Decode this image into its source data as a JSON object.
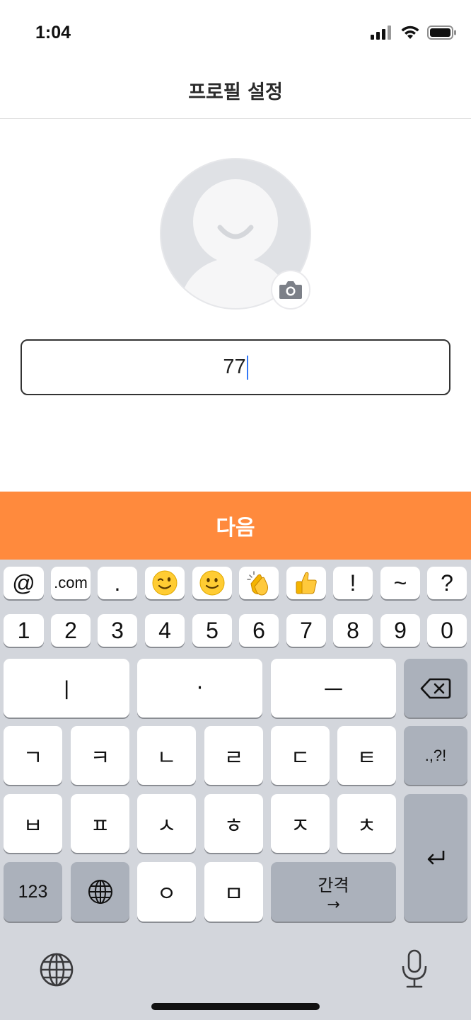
{
  "status_bar": {
    "time": "1:04"
  },
  "header": {
    "title": "프로필 설정"
  },
  "profile": {
    "avatar_icon": "default-avatar-icon",
    "camera_icon": "camera-icon",
    "name_value": "77"
  },
  "next_button": {
    "label": "다음",
    "color": "#ff8a3d"
  },
  "keyboard": {
    "suggestion_row": [
      "@",
      ".com",
      ".",
      "wink-emoji",
      "smile-emoji",
      "clap-emoji",
      "thumbs-up-emoji",
      "!",
      "~",
      "?"
    ],
    "number_row": [
      "1",
      "2",
      "3",
      "4",
      "5",
      "6",
      "7",
      "8",
      "9",
      "0"
    ],
    "vowel_row": [
      "ㅣ",
      "·",
      "ㅡ"
    ],
    "row2": [
      "ㄱ",
      "ㅋ",
      "ㄴ",
      "ㄹ",
      "ㄷ",
      "ㅌ"
    ],
    "punct_label": ".,?!",
    "row3": [
      "ㅂ",
      "ㅍ",
      "ㅅ",
      "ㅎ",
      "ㅈ",
      "ㅊ"
    ],
    "numbers_key": "123",
    "row4": [
      "ㅇ",
      "ㅁ"
    ],
    "space_label": "간격",
    "space_arrow": "→"
  }
}
